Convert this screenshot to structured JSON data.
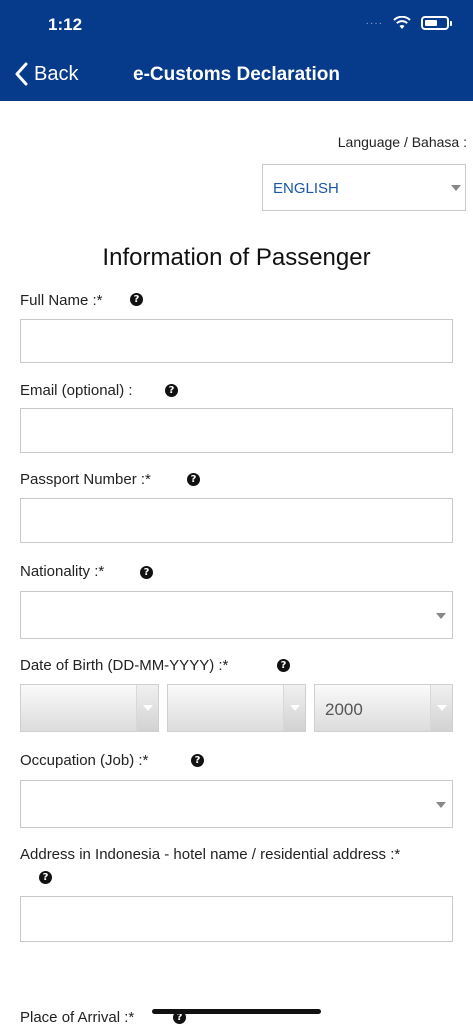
{
  "status_bar": {
    "time": "1:12",
    "signal": "····"
  },
  "nav": {
    "back_label": "Back",
    "title": "e-Customs Declaration"
  },
  "language": {
    "label": "Language / Bahasa :",
    "selected": "ENGLISH"
  },
  "section_title": "Information of Passenger",
  "fields": {
    "full_name": {
      "label": "Full Name :*",
      "value": ""
    },
    "email": {
      "label": "Email (optional) :",
      "value": ""
    },
    "passport": {
      "label": "Passport Number :*",
      "value": ""
    },
    "nationality": {
      "label": "Nationality :*",
      "value": ""
    },
    "dob": {
      "label": "Date of Birth (DD-MM-YYYY) :*",
      "day": "",
      "month": "",
      "year": "2000"
    },
    "occupation": {
      "label": "Occupation (Job) :*",
      "value": ""
    },
    "address": {
      "label": "Address in Indonesia - hotel name / residential address :*",
      "value": ""
    },
    "arrival": {
      "label": "Place of Arrival :*"
    }
  },
  "help_glyph": "?",
  "colors": {
    "header": "#063a8a",
    "link": "#1b57a6",
    "border": "#c9c9c9"
  }
}
